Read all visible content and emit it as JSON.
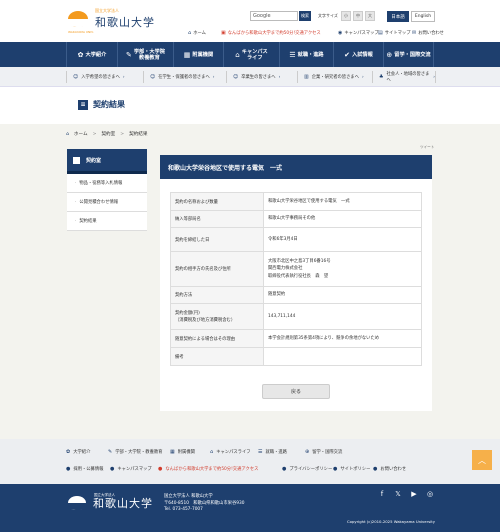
{
  "header": {
    "logo_small": "国立大学法人",
    "logo_name": "和歌山大学",
    "logo_en": "WAKAYAMA UNIV.",
    "search_brand": "Google",
    "search_button": "検索",
    "font_size_label": "文字サイズ",
    "font_sizes": [
      "小",
      "中",
      "大"
    ],
    "lang_jp": "日本語",
    "lang_en": "English",
    "util_links": [
      {
        "icon": "home-icon",
        "label": "ホーム"
      },
      {
        "icon": "train-icon",
        "label": "なんばから和歌山大学まで約50分!交通アクセス"
      },
      {
        "icon": "map-icon",
        "label": "キャンパスマップ"
      },
      {
        "icon": "sitemap-icon",
        "label": "サイトマップ"
      },
      {
        "icon": "mail-icon",
        "label": "お問い合わせ"
      }
    ]
  },
  "gnav": [
    {
      "icon": "✿",
      "label": "大学紹介"
    },
    {
      "icon": "✎",
      "label": "学部・大学院\n教養教育"
    },
    {
      "icon": "▦",
      "label": "附属機関"
    },
    {
      "icon": "⌂",
      "label": "キャンパス\nライフ"
    },
    {
      "icon": "☰",
      "label": "就職・進路"
    },
    {
      "icon": "✔",
      "label": "入試情報"
    },
    {
      "icon": "⊕",
      "label": "留学・国際交流"
    }
  ],
  "audience": [
    {
      "label": "入学希望の皆さまへ"
    },
    {
      "label": "在学生・保護者の皆さまへ"
    },
    {
      "label": "卒業生の皆さまへ"
    },
    {
      "label": "企業・研究者の皆さまへ"
    },
    {
      "label": "社会人・地域の皆さまへ"
    }
  ],
  "page": {
    "title": "契約結果"
  },
  "breadcrumb": [
    "ホーム",
    ">",
    "契約室",
    ">",
    "契約結果"
  ],
  "small_link": "ツイート",
  "sidebar": {
    "title": "契約室",
    "items": [
      "物品・役務等入札情報",
      "公開見積合わせ情報",
      "契約結果"
    ]
  },
  "main": {
    "heading": "和歌山大学栄谷地区で使用する電気　一式",
    "rows": [
      {
        "key": "契約の名称および数量",
        "value": "和歌山大学栄谷地区で使用する電気　一式"
      },
      {
        "key": "納入等部局名",
        "value": "和歌山大学事務局その他"
      },
      {
        "key": "契約を締結した日",
        "value": "令和6年3月4日"
      },
      {
        "key": "契約の相手方の氏名及び住所",
        "value": "大阪市北区中之島3丁目6番16号\n関西電力株式会社\n取締役代表執行役社長　森　望"
      },
      {
        "key": "契約方法",
        "value": "随意契約"
      },
      {
        "key": "契約金額(円)\n（消費税及び地方消費税含む）",
        "value": "143,711,144"
      },
      {
        "key": "随意契約による場合はその理由",
        "value": "本学会計規則第35条第4項により、競争の余地がないため"
      },
      {
        "key": "備考",
        "value": ""
      }
    ],
    "back_button": "戻る"
  },
  "footer_nav": [
    {
      "icon": "✿",
      "label": "大学紹介"
    },
    {
      "icon": "✎",
      "label": "学部・大学院・教養教育"
    },
    {
      "icon": "▦",
      "label": "附属機関"
    },
    {
      "icon": "⌂",
      "label": "キャンパスライフ"
    },
    {
      "icon": "☰",
      "label": "就職・進路"
    },
    {
      "icon": "⊕",
      "label": "留学・国際交流"
    }
  ],
  "footer_links": [
    {
      "icon": "●",
      "label": "採用・公募情報"
    },
    {
      "icon": "●",
      "label": "キャンパスマップ"
    },
    {
      "icon": "●",
      "label": "なんばから和歌山大学まで約50分!交通アクセス",
      "red": true
    },
    {
      "icon": "●",
      "label": "プライバシーポリシー"
    },
    {
      "icon": "●",
      "label": "サイトポリシー"
    },
    {
      "icon": "●",
      "label": "お問い合わせ"
    }
  ],
  "footer": {
    "logo_small": "国立大学法人",
    "logo_name": "和歌山大学",
    "address_line1": "国立大学法人 和歌山大学",
    "address_line2": "〒640-8510　和歌山県和歌山市栄谷930",
    "address_line3": "Tel. 073-457-7007",
    "copyright": "Copyright (c)2010-2025 Wakayama University"
  },
  "colors": {
    "navy": "#1e3f6e",
    "accent": "#f39a1e",
    "red": "#d23c2c"
  }
}
